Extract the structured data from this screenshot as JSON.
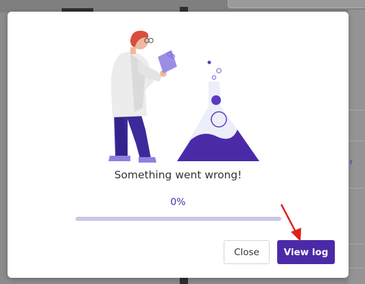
{
  "dialog": {
    "message": "Something went wrong!",
    "progress_text": "0%",
    "progress_value": 0,
    "close_label": "Close",
    "view_log_label": "View log"
  },
  "background": {
    "link_fragment": "r"
  },
  "colors": {
    "accent": "#4b2aa8",
    "progress_track": "#c9c9e4",
    "annotation_arrow": "#e0201c"
  },
  "icons": {
    "illustration": "scientist-with-flask-illustration",
    "annotation": "red-arrow-icon"
  }
}
